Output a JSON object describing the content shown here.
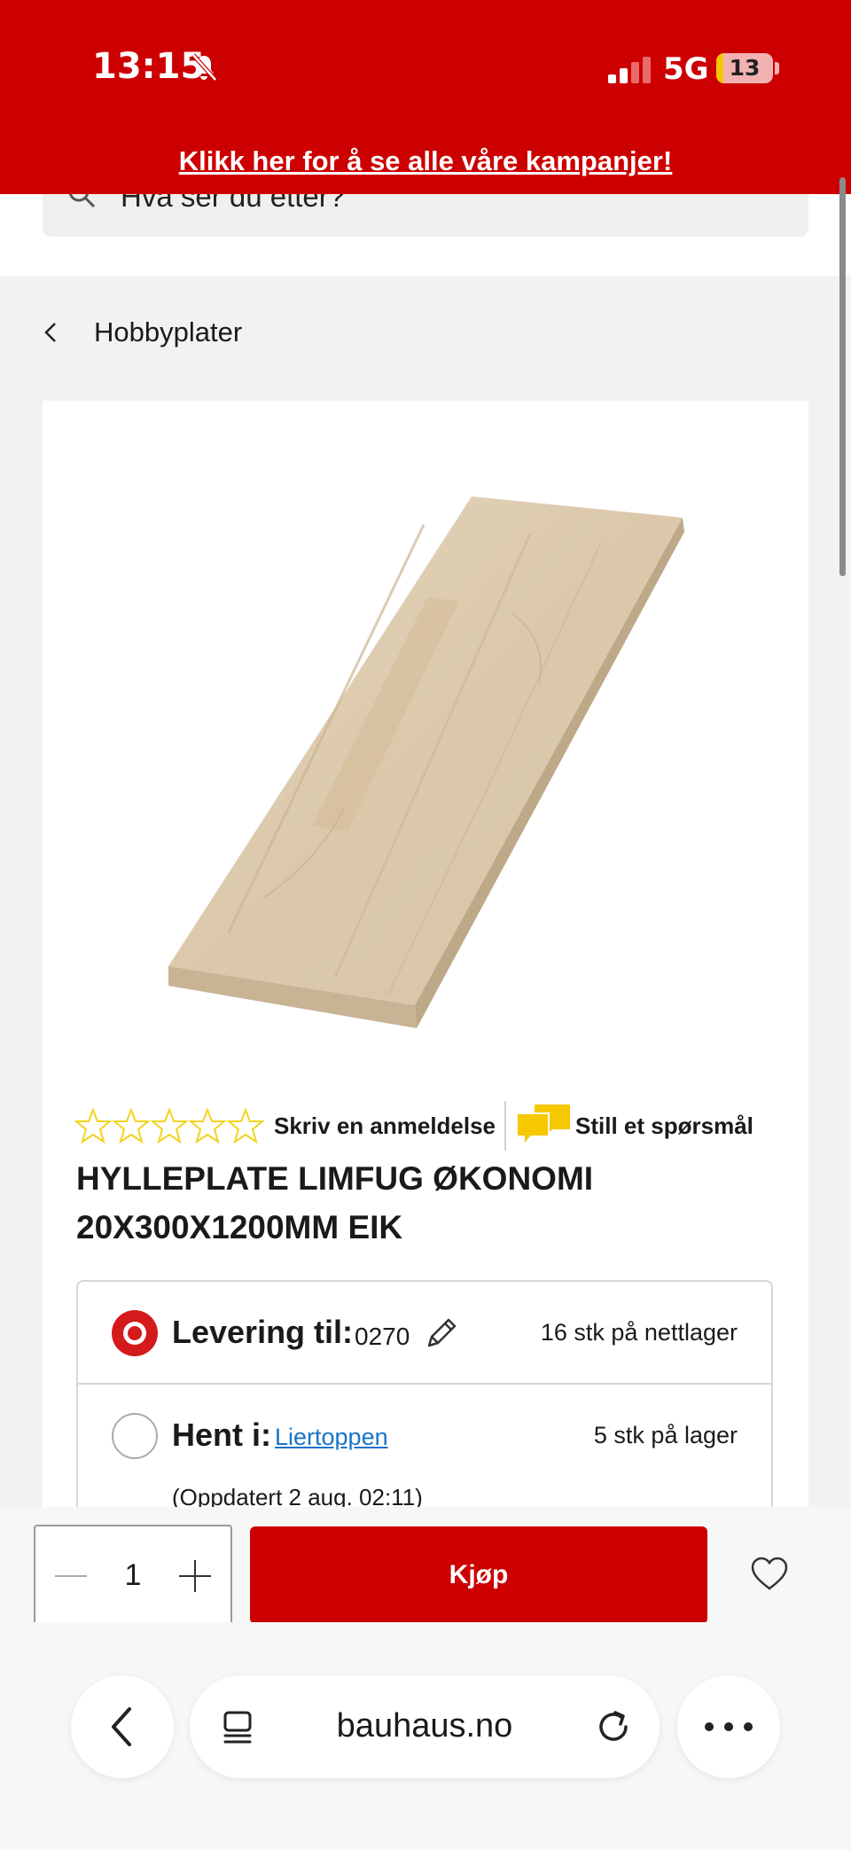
{
  "status_bar": {
    "time": "13:15",
    "network": "5G",
    "battery": "13",
    "battery_level_percent": 13
  },
  "banner": {
    "campaign_link": "Klikk her for å se alle våre kampanjer!"
  },
  "search": {
    "placeholder": "Hva ser du etter?"
  },
  "breadcrumb": {
    "label": "Hobbyplater"
  },
  "product": {
    "rating": {
      "stars_filled": 0,
      "stars_total": 5
    },
    "review_link": "Skriv en anmeldelse",
    "question_link": "Still et spørsmål",
    "title_line1": "HYLLEPLATE LIMFUG ØKONOMI",
    "title_line2": "20X300X1200MM EIK"
  },
  "delivery": {
    "option1_label": "Levering til:",
    "postcode": "0270",
    "option1_stock": "16 stk på nettlager",
    "option2_label": "Hent i:",
    "store": "Liertoppen",
    "option2_stock": "5 stk på lager",
    "updated": "(Oppdatert 2 aug. 02:11)"
  },
  "buy_bar": {
    "quantity": "1",
    "buy_label": "Kjøp"
  },
  "browser": {
    "url": "bauhaus.no"
  },
  "colors": {
    "brand_red": "#cc0000",
    "link_blue": "#1a73c7",
    "star_yellow": "#f2d320"
  }
}
